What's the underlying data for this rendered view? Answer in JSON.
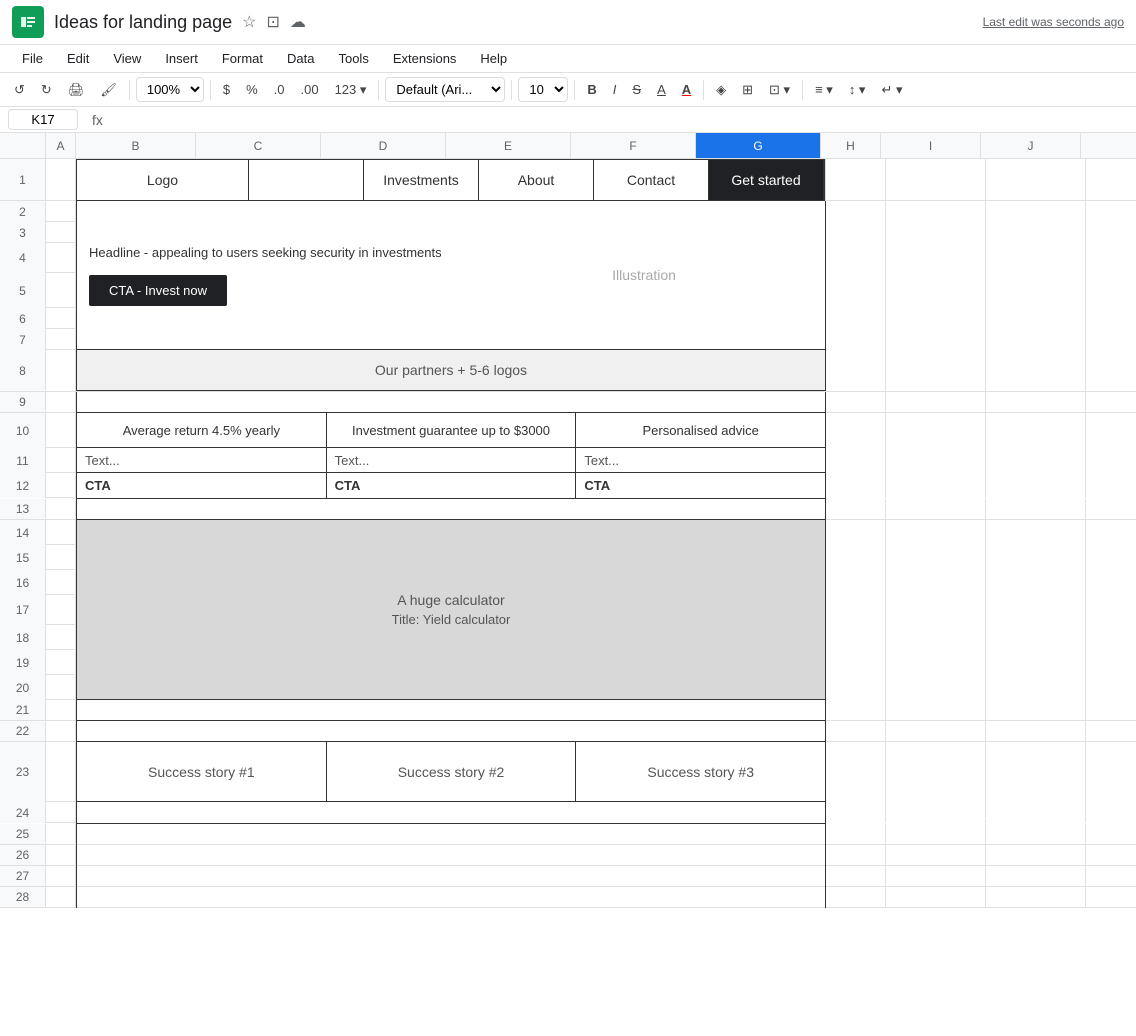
{
  "titleBar": {
    "appIcon": "S",
    "title": "Ideas for landing page",
    "lastEdit": "Last edit was seconds ago"
  },
  "menuBar": {
    "items": [
      "File",
      "Edit",
      "View",
      "Insert",
      "Format",
      "Data",
      "Tools",
      "Extensions",
      "Help"
    ]
  },
  "toolbar": {
    "zoom": "100%",
    "currency": "$",
    "percent": "%",
    "decimal1": ".0",
    "decimal2": ".00",
    "format123": "123",
    "font": "Default (Ari...",
    "fontSize": "10",
    "bold": "B",
    "italic": "I",
    "strikethrough": "S",
    "underline": "A"
  },
  "formulaBar": {
    "cellRef": "K17",
    "fx": "fx"
  },
  "columnHeaders": [
    "A",
    "B",
    "C",
    "D",
    "E",
    "F",
    "G",
    "H",
    "I",
    "J"
  ],
  "rowNumbers": [
    1,
    2,
    3,
    4,
    5,
    6,
    7,
    8,
    9,
    10,
    11,
    12,
    13,
    14,
    15,
    16,
    17,
    18,
    19,
    20,
    21,
    22,
    23,
    24,
    25,
    26,
    27,
    28
  ],
  "selectedCell": "G",
  "design": {
    "nav": {
      "logo": "Logo",
      "investments": "Investments",
      "about": "About",
      "contact": "Contact",
      "getStarted": "Get started"
    },
    "hero": {
      "headline": "Headline - appealing to users seeking security in investments",
      "cta": "CTA - Invest now",
      "illustration": "Illustration"
    },
    "partners": {
      "text": "Our partners + 5-6 logos"
    },
    "features": [
      {
        "title": "Average return 4.5% yearly",
        "text": "Text...",
        "cta": "CTA"
      },
      {
        "title": "Investment guarantee up to $3000",
        "text": "Text...",
        "cta": "CTA"
      },
      {
        "title": "Personalised advice",
        "text": "Text...",
        "cta": "CTA"
      }
    ],
    "calculator": {
      "line1": "A huge calculator",
      "line2": "Title: Yield calculator"
    },
    "successStories": [
      "Success story #1",
      "Success story #2",
      "Success story #3"
    ]
  }
}
